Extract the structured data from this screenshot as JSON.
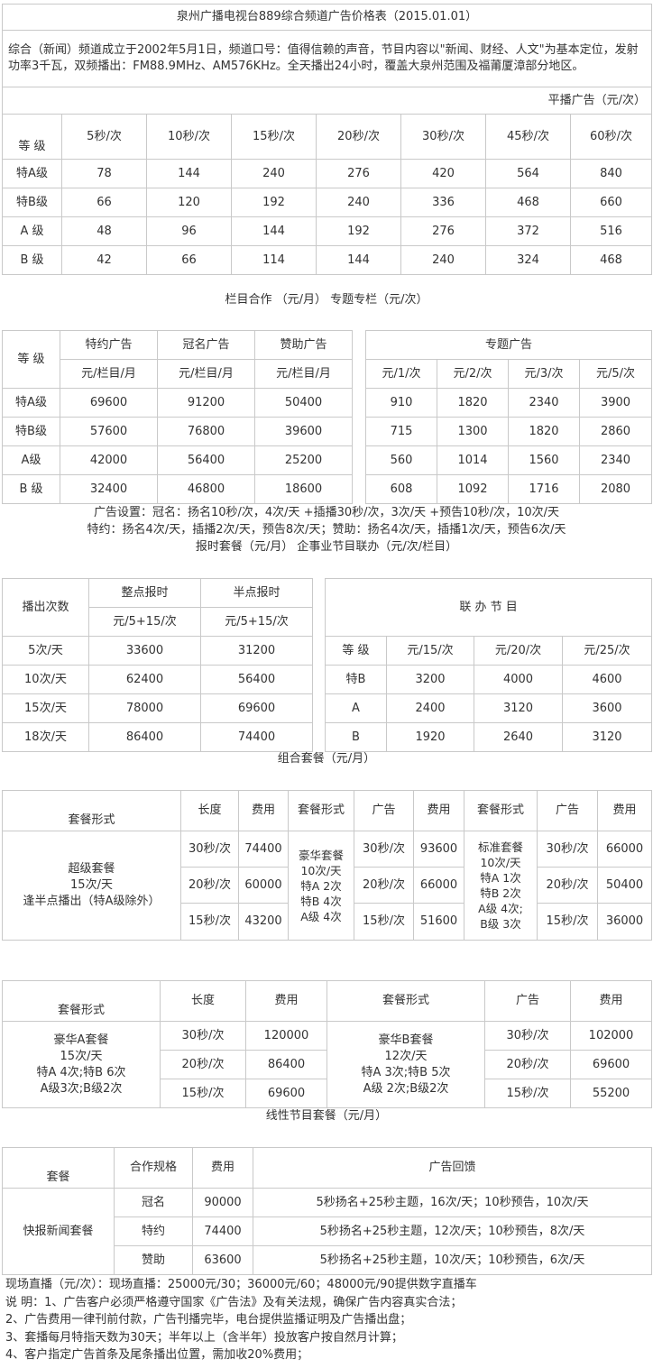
{
  "title": "泉州广播电视台889综合频道广告价格表（2015.01.01）",
  "intro": "综合（新闻）频道成立于2002年5月1日，频道口号：值得信赖的声音，节目内容以\"新闻、财经、人文\"为基本定位，发射功率3千瓦，双频播出：FM88.9MHz、AM576KHz。全天播出24小时，覆盖大泉州范围及福莆厦漳部分地区。",
  "regular": {
    "section_label": "平播广告（元/次）",
    "grade_header": "等 级",
    "columns": [
      "5秒/次",
      "10秒/次",
      "15秒/次",
      "20秒/次",
      "30秒/次",
      "45秒/次",
      "60秒/次"
    ],
    "rows": [
      {
        "grade": "特A级",
        "values": [
          "78",
          "144",
          "240",
          "276",
          "420",
          "564",
          "840"
        ]
      },
      {
        "grade": "特B级",
        "values": [
          "66",
          "120",
          "192",
          "240",
          "336",
          "468",
          "660"
        ]
      },
      {
        "grade": "A 级",
        "values": [
          "48",
          "96",
          "144",
          "192",
          "276",
          "372",
          "516"
        ]
      },
      {
        "grade": "B 级",
        "values": [
          "42",
          "66",
          "114",
          "144",
          "240",
          "324",
          "468"
        ]
      }
    ]
  },
  "column_coop": {
    "caption": "栏目合作 （元/月） 专题专栏（元/次）",
    "grade_header": "等 级",
    "types": [
      "特约广告",
      "冠名广告",
      "赞助广告"
    ],
    "unit": "元/栏目/月",
    "special_header": "专题广告",
    "special_units": [
      "元/1/次",
      "元/2/次",
      "元/3/次",
      "元/5/次"
    ],
    "rows": [
      {
        "grade": "特A级",
        "values": [
          "69600",
          "91200",
          "50400"
        ],
        "special": [
          "910",
          "1820",
          "2340",
          "3900"
        ]
      },
      {
        "grade": "特B级",
        "values": [
          "57600",
          "76800",
          "39600"
        ],
        "special": [
          "715",
          "1300",
          "1820",
          "2860"
        ]
      },
      {
        "grade": "A级",
        "values": [
          "42000",
          "56400",
          "25200"
        ],
        "special": [
          "560",
          "1014",
          "1560",
          "2340"
        ]
      },
      {
        "grade": "B 级",
        "values": [
          "32400",
          "46800",
          "18600"
        ],
        "special": [
          "608",
          "1092",
          "1716",
          "2080"
        ]
      }
    ],
    "notes": [
      "广告设置：冠名：扬名10秒/次，4次/天 +插播30秒/次，3次/天 +预告10秒/次，10次/天",
      "特约：扬名4次/天，插播2次/天，预告8次/天；赞助：扬名4次/天，插播1次/天，预告6次/天",
      "报时套餐（元/月） 企事业节目联办（元/次/栏目）"
    ]
  },
  "time_signal": {
    "count_header": "播出次数",
    "types": [
      "整点报时",
      "半点报时"
    ],
    "unit": "元/5+15/次",
    "rows": [
      {
        "count": "5次/天",
        "values": [
          "33600",
          "31200"
        ]
      },
      {
        "count": "10次/天",
        "values": [
          "62400",
          "56400"
        ]
      },
      {
        "count": "15次/天",
        "values": [
          "78000",
          "69600"
        ]
      },
      {
        "count": "18次/天",
        "values": [
          "86400",
          "74400"
        ]
      }
    ],
    "joint_header": "联 办 节 目",
    "joint_grade_header": "等 级",
    "joint_units": [
      "元/15/次",
      "元/20/次",
      "元/25/次"
    ],
    "joint_rows": [
      {
        "grade": "特B",
        "values": [
          "3200",
          "4000",
          "4600"
        ]
      },
      {
        "grade": "A",
        "values": [
          "2400",
          "3120",
          "3600"
        ]
      },
      {
        "grade": "B",
        "values": [
          "1920",
          "2640",
          "3120"
        ]
      }
    ]
  },
  "combo": {
    "caption": "组合套餐（元/月）",
    "headers": [
      "套餐形式",
      "长度",
      "费用",
      "套餐形式",
      "广告",
      "费用",
      "套餐形式",
      "广告",
      "费用"
    ],
    "super_name": [
      "超级套餐",
      "15次/天",
      "逢半点播出（特A级除外）"
    ],
    "super_rows": [
      [
        "30秒/次",
        "74400"
      ],
      [
        "20秒/次",
        "60000"
      ],
      [
        "15秒/次",
        "43200"
      ]
    ],
    "luxury_name": [
      "豪华套餐",
      "10次/天",
      "特A 2次",
      "特B 4次",
      "A级 4次"
    ],
    "luxury_rows": [
      [
        "30秒/次",
        "93600"
      ],
      [
        "20秒/次",
        "66000"
      ],
      [
        "15秒/次",
        "51600"
      ]
    ],
    "standard_name": [
      "标准套餐",
      "10次/天",
      "特A 1次",
      "特B 2次",
      "A级 4次;",
      "B级 3次"
    ],
    "standard_rows": [
      [
        "30秒/次",
        "66000"
      ],
      [
        "20秒/次",
        "50400"
      ],
      [
        "15秒/次",
        "36000"
      ]
    ]
  },
  "luxury_ab": {
    "headers": [
      "套餐形式",
      "长度",
      "费用",
      "套餐形式",
      "广告",
      "费用"
    ],
    "a_name": [
      "豪华A套餐",
      "15次/天",
      "特A 4次;特B 6次",
      "A级3次;B级2次"
    ],
    "a_rows": [
      [
        "30秒/次",
        "120000"
      ],
      [
        "20秒/次",
        "86400"
      ],
      [
        "15秒/次",
        "69600"
      ]
    ],
    "b_name": [
      "豪华B套餐",
      "12次/天",
      "特A 3次;特B 5次",
      "A级 2次;B级2次"
    ],
    "b_rows": [
      [
        "30秒/次",
        "102000"
      ],
      [
        "20秒/次",
        "69600"
      ],
      [
        "15秒/次",
        "55200"
      ]
    ],
    "caption": "线性节目套餐（元/月）"
  },
  "linear": {
    "headers": [
      "套餐",
      "合作规格",
      "费用",
      "广告回馈"
    ],
    "package_name": "快报新闻套餐",
    "rows": [
      {
        "spec": "冠名",
        "price": "90000",
        "feedback": "5秒扬名+25秒主题，16次/天；10秒预告，10次/天"
      },
      {
        "spec": "特约",
        "price": "74400",
        "feedback": "5秒扬名+25秒主题，12次/天；10秒预告，8次/天"
      },
      {
        "spec": "赞助",
        "price": "63600",
        "feedback": "5秒扬名+25秒主题，10次/天；10秒预告，6次/天"
      }
    ]
  },
  "footer_notes": [
    "现场直播（元/次）：现场直播：25000元/30；36000元/60；48000元/90提供数字直播车",
    "说 明：1、广告客户必须严格遵守国家《广告法》及有关法规，确保广告内容真实合法；",
    "2、广告费用一律刊前付款，广告刊播完毕，电台提供监播证明及广告播出盘；",
    "3、套播每月特指天数为30天；半年以上（含半年）投放客户按自然月计算；",
    "4、客户指定广告首条及尾条播出位置，需加收20%费用；"
  ]
}
